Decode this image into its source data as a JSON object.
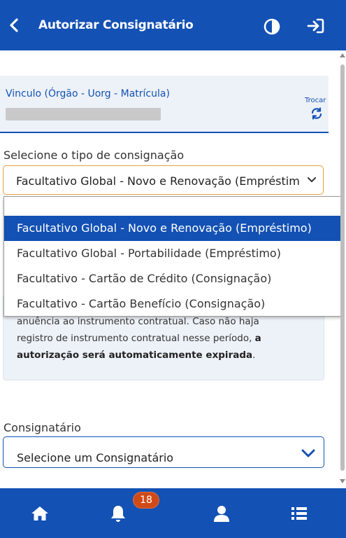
{
  "header": {
    "title": "Autorizar Consignatário",
    "back_icon": "chevron-left-icon",
    "contrast_icon": "contrast-icon",
    "logout_icon": "sign-out-icon"
  },
  "vinculo": {
    "label": "Vinculo (Órgão - Uorg - Matrícula)",
    "trocar_label": "Trocar",
    "trocar_icon": "refresh-icon"
  },
  "tipo": {
    "label": "Selecione o tipo de consignação",
    "selected": "Facultativo Global - Novo e Renovação (Empréstimo)",
    "options": [
      "Facultativo Global - Novo e Renovação (Empréstimo)",
      "Facultativo Global - Portabilidade (Empréstimo)",
      "Facultativo - Cartão de Crédito (Consignação)",
      "Facultativo - Cartão Benefício (Consignação)"
    ]
  },
  "info": {
    "line1": "anuência ao instrumento contratual. Caso não haja",
    "line2_prefix": "registro de instrumento contratual nesse período, ",
    "line2_bold": "a",
    "line3_bold": "autorização será automaticamente expirada",
    "line3_suffix": "."
  },
  "consignatario": {
    "label": "Consignatário",
    "placeholder": "Selecione um Consignatário"
  },
  "bottom_nav": {
    "home_icon": "home-icon",
    "notifications_icon": "bell-icon",
    "notifications_count": "18",
    "profile_icon": "user-icon",
    "menu_icon": "list-icon"
  },
  "colors": {
    "primary": "#1351b4",
    "badge": "#d04a18",
    "focus_border": "#e5a33b"
  }
}
